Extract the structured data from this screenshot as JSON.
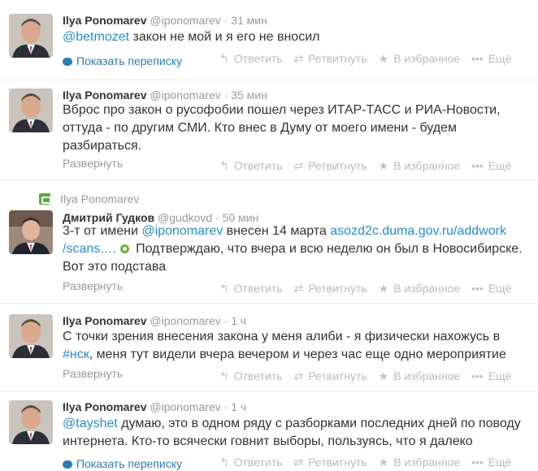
{
  "actions": {
    "reply": "Ответить",
    "retweet": "Ретвитнуть",
    "favorite": "В избранное",
    "more": "Ещё"
  },
  "icons": {
    "reply": "reply-arrow-icon",
    "retweet": "retweet-icon",
    "favorite": "star-icon",
    "more": "more-dots-icon",
    "conversation": "speech-bubble-icon"
  },
  "colors": {
    "link": "#2a8bc9",
    "retweet_green": "#5aa844",
    "muted": "#999999"
  },
  "tweets": [
    {
      "fullname": "Ilya Ponomarev",
      "username": "@iponomarev",
      "time": "31 мин",
      "mention": "@betmozet",
      "text": " закон не мой и я его не вносил",
      "footer": "Показать переписку"
    },
    {
      "fullname": "Ilya Ponomarev",
      "username": "@iponomarev",
      "time": "35 мин",
      "text": "Вброс про закон о русофобии пошел через ИТАР-ТАСС и РИА-Новости, оттуда - по другим СМИ. Кто внес в Думу от моего имени - будем разбираться.",
      "footer": "Развернуть"
    },
    {
      "retweeted_by": "Ilya Ponomarev",
      "fullname": "Дмитрий Гудков",
      "username": "@gudkovd",
      "time": "50 мин",
      "text_a": "3-т от имени ",
      "mention": "@iponomarev",
      "text_b": " внесен 14 марта ",
      "url_a": "asozd2c.duma.gov.ru/addwork",
      "url_b": "/scans.…",
      "text_c": " Подтверждаю, что вчера и всю неделю он был в Новосибирске. Вот это подстава",
      "footer": "Развернуть"
    },
    {
      "fullname": "Ilya Ponomarev",
      "username": "@iponomarev",
      "time": "1 ч",
      "text_a": "С точки зрения внесения закона у меня алиби - я физически нахожусь в ",
      "hashtag": "#нск",
      "text_b": ", меня тут видели вчера вечером и через час еще одно мероприятие",
      "footer": "Развернуть"
    },
    {
      "fullname": "Ilya Ponomarev",
      "username": "@iponomarev",
      "time": "1 ч",
      "mention": "@tayshet",
      "text": " думаю, это в одном ряду с разборками последних дней по поводу интернета. Кто-то всячески говнит выборы, пользуясь, что я далеко",
      "footer": "Показать переписку"
    }
  ]
}
